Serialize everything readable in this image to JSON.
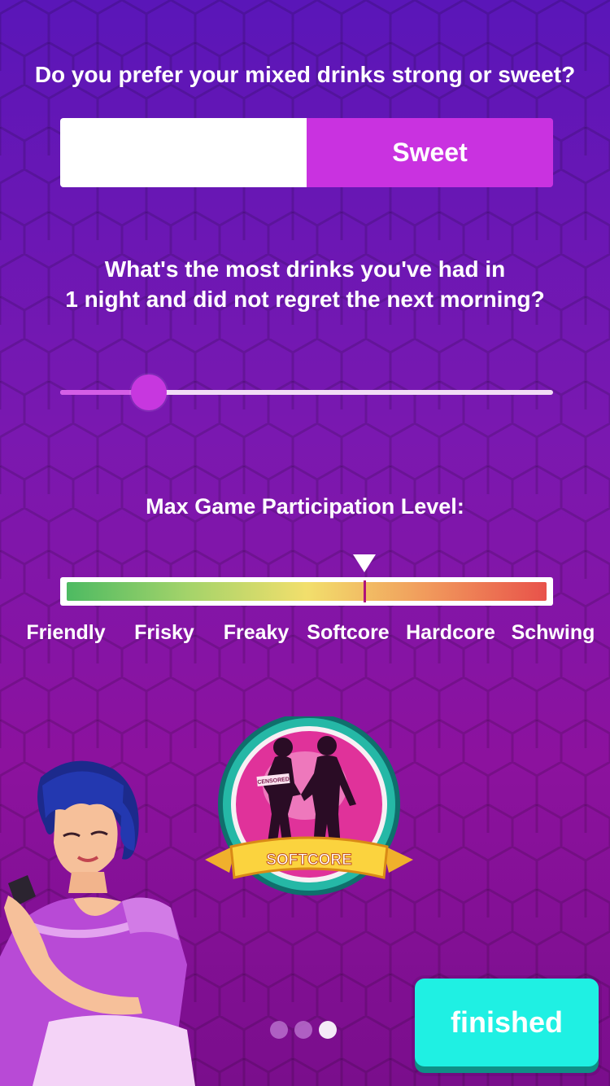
{
  "question1": {
    "text": "Do you prefer your mixed drinks strong or sweet?",
    "option_left": "",
    "option_right": "Sweet",
    "selected": "right"
  },
  "question2": {
    "line1": "What's the most drinks you've had in",
    "line2": "1 night and did not regret the next morning?",
    "slider_value_fraction": 0.18
  },
  "participation": {
    "title": "Max Game Participation Level:",
    "levels": [
      "Friendly",
      "Frisky",
      "Freaky",
      "Softcore",
      "Hardcore",
      "Schwing"
    ],
    "selected_level": "Softcore",
    "selected_fraction": 0.62
  },
  "badge": {
    "label": "SOFTCORE",
    "censored_text": "CENSORED"
  },
  "pager": {
    "total": 3,
    "active_index": 2
  },
  "finish_button": {
    "label": "finished"
  },
  "colors": {
    "accent": "#c932e0",
    "finish_button": "#1ff0e3",
    "background_top": "#5a16b8",
    "background_bottom": "#7a0e8c"
  }
}
